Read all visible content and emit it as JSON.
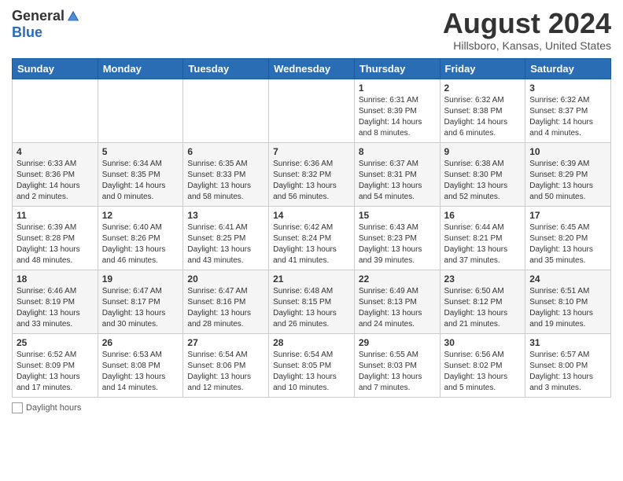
{
  "logo": {
    "general": "General",
    "blue": "Blue"
  },
  "title": "August 2024",
  "location": "Hillsboro, Kansas, United States",
  "days_of_week": [
    "Sunday",
    "Monday",
    "Tuesday",
    "Wednesday",
    "Thursday",
    "Friday",
    "Saturday"
  ],
  "weeks": [
    [
      {
        "day": "",
        "info": ""
      },
      {
        "day": "",
        "info": ""
      },
      {
        "day": "",
        "info": ""
      },
      {
        "day": "",
        "info": ""
      },
      {
        "day": "1",
        "info": "Sunrise: 6:31 AM\nSunset: 8:39 PM\nDaylight: 14 hours\nand 8 minutes."
      },
      {
        "day": "2",
        "info": "Sunrise: 6:32 AM\nSunset: 8:38 PM\nDaylight: 14 hours\nand 6 minutes."
      },
      {
        "day": "3",
        "info": "Sunrise: 6:32 AM\nSunset: 8:37 PM\nDaylight: 14 hours\nand 4 minutes."
      }
    ],
    [
      {
        "day": "4",
        "info": "Sunrise: 6:33 AM\nSunset: 8:36 PM\nDaylight: 14 hours\nand 2 minutes."
      },
      {
        "day": "5",
        "info": "Sunrise: 6:34 AM\nSunset: 8:35 PM\nDaylight: 14 hours\nand 0 minutes."
      },
      {
        "day": "6",
        "info": "Sunrise: 6:35 AM\nSunset: 8:33 PM\nDaylight: 13 hours\nand 58 minutes."
      },
      {
        "day": "7",
        "info": "Sunrise: 6:36 AM\nSunset: 8:32 PM\nDaylight: 13 hours\nand 56 minutes."
      },
      {
        "day": "8",
        "info": "Sunrise: 6:37 AM\nSunset: 8:31 PM\nDaylight: 13 hours\nand 54 minutes."
      },
      {
        "day": "9",
        "info": "Sunrise: 6:38 AM\nSunset: 8:30 PM\nDaylight: 13 hours\nand 52 minutes."
      },
      {
        "day": "10",
        "info": "Sunrise: 6:39 AM\nSunset: 8:29 PM\nDaylight: 13 hours\nand 50 minutes."
      }
    ],
    [
      {
        "day": "11",
        "info": "Sunrise: 6:39 AM\nSunset: 8:28 PM\nDaylight: 13 hours\nand 48 minutes."
      },
      {
        "day": "12",
        "info": "Sunrise: 6:40 AM\nSunset: 8:26 PM\nDaylight: 13 hours\nand 46 minutes."
      },
      {
        "day": "13",
        "info": "Sunrise: 6:41 AM\nSunset: 8:25 PM\nDaylight: 13 hours\nand 43 minutes."
      },
      {
        "day": "14",
        "info": "Sunrise: 6:42 AM\nSunset: 8:24 PM\nDaylight: 13 hours\nand 41 minutes."
      },
      {
        "day": "15",
        "info": "Sunrise: 6:43 AM\nSunset: 8:23 PM\nDaylight: 13 hours\nand 39 minutes."
      },
      {
        "day": "16",
        "info": "Sunrise: 6:44 AM\nSunset: 8:21 PM\nDaylight: 13 hours\nand 37 minutes."
      },
      {
        "day": "17",
        "info": "Sunrise: 6:45 AM\nSunset: 8:20 PM\nDaylight: 13 hours\nand 35 minutes."
      }
    ],
    [
      {
        "day": "18",
        "info": "Sunrise: 6:46 AM\nSunset: 8:19 PM\nDaylight: 13 hours\nand 33 minutes."
      },
      {
        "day": "19",
        "info": "Sunrise: 6:47 AM\nSunset: 8:17 PM\nDaylight: 13 hours\nand 30 minutes."
      },
      {
        "day": "20",
        "info": "Sunrise: 6:47 AM\nSunset: 8:16 PM\nDaylight: 13 hours\nand 28 minutes."
      },
      {
        "day": "21",
        "info": "Sunrise: 6:48 AM\nSunset: 8:15 PM\nDaylight: 13 hours\nand 26 minutes."
      },
      {
        "day": "22",
        "info": "Sunrise: 6:49 AM\nSunset: 8:13 PM\nDaylight: 13 hours\nand 24 minutes."
      },
      {
        "day": "23",
        "info": "Sunrise: 6:50 AM\nSunset: 8:12 PM\nDaylight: 13 hours\nand 21 minutes."
      },
      {
        "day": "24",
        "info": "Sunrise: 6:51 AM\nSunset: 8:10 PM\nDaylight: 13 hours\nand 19 minutes."
      }
    ],
    [
      {
        "day": "25",
        "info": "Sunrise: 6:52 AM\nSunset: 8:09 PM\nDaylight: 13 hours\nand 17 minutes."
      },
      {
        "day": "26",
        "info": "Sunrise: 6:53 AM\nSunset: 8:08 PM\nDaylight: 13 hours\nand 14 minutes."
      },
      {
        "day": "27",
        "info": "Sunrise: 6:54 AM\nSunset: 8:06 PM\nDaylight: 13 hours\nand 12 minutes."
      },
      {
        "day": "28",
        "info": "Sunrise: 6:54 AM\nSunset: 8:05 PM\nDaylight: 13 hours\nand 10 minutes."
      },
      {
        "day": "29",
        "info": "Sunrise: 6:55 AM\nSunset: 8:03 PM\nDaylight: 13 hours\nand 7 minutes."
      },
      {
        "day": "30",
        "info": "Sunrise: 6:56 AM\nSunset: 8:02 PM\nDaylight: 13 hours\nand 5 minutes."
      },
      {
        "day": "31",
        "info": "Sunrise: 6:57 AM\nSunset: 8:00 PM\nDaylight: 13 hours\nand 3 minutes."
      }
    ]
  ],
  "footer": {
    "daylight_label": "Daylight hours"
  }
}
